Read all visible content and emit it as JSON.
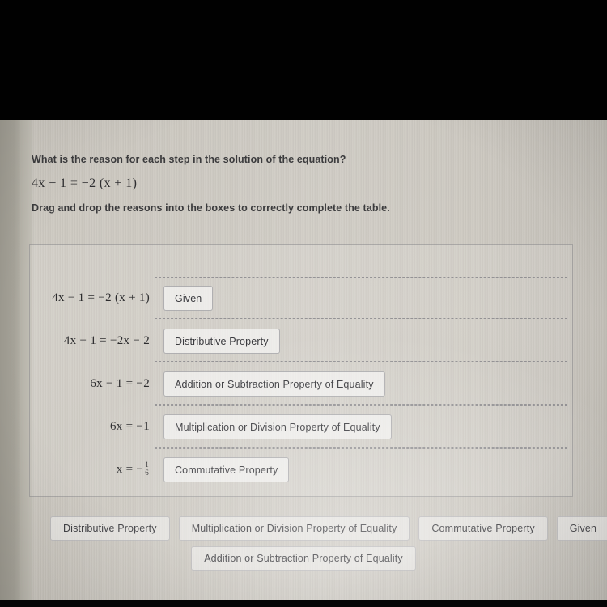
{
  "question": {
    "prompt": "What is the reason for each step in the solution of the equation?",
    "equation": "4x − 1 = −2 (x + 1)",
    "instruction": "Drag and drop the reasons into the boxes to correctly complete the table."
  },
  "table": {
    "rows": [
      {
        "equation": "4x − 1 = −2 (x + 1)",
        "reason": "Given"
      },
      {
        "equation": "4x − 1 = −2x − 2",
        "reason": "Distributive Property"
      },
      {
        "equation": "6x − 1 = −2",
        "reason": "Addition or Subtraction Property of Equality"
      },
      {
        "equation": "6x = −1",
        "reason": "Multiplication or Division Property of Equality"
      },
      {
        "equation_prefix": "x = −",
        "equation_numerator": "1",
        "equation_denominator": "6",
        "reason": "Commutative Property"
      }
    ]
  },
  "answer_bank": {
    "row1": [
      "Distributive Property",
      "Multiplication or Division Property of Equality",
      "Commutative Property",
      "Given"
    ],
    "row2": [
      "Addition or Subtraction Property of Equality"
    ]
  }
}
